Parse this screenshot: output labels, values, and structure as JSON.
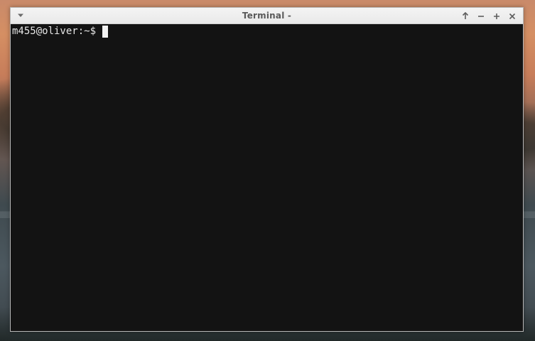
{
  "window": {
    "title": "Terminal -"
  },
  "terminal": {
    "prompt": "m455@oliver:~$"
  },
  "icons": {
    "menu": "chevron-down-icon",
    "above": "arrow-up-icon",
    "minimize": "minimize-icon",
    "maximize": "maximize-icon",
    "close": "close-icon"
  },
  "colors": {
    "terminal_bg": "#131313",
    "titlebar_bg": "#eeeeee",
    "title_text": "#5a5a5a",
    "prompt_text": "#e6e6e6",
    "cursor": "#f2f2f2"
  }
}
